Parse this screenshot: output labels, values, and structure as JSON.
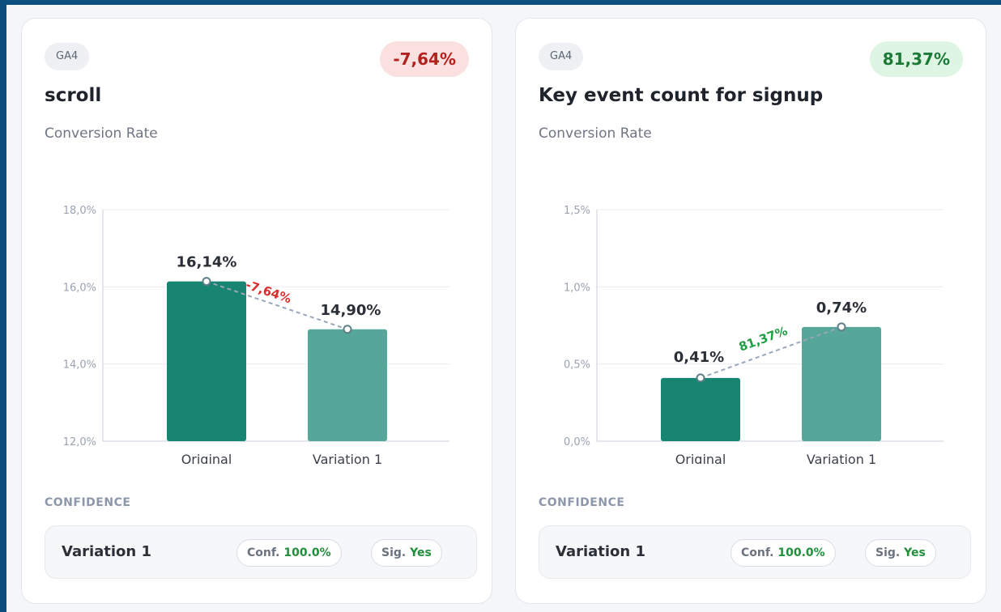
{
  "cards": [
    {
      "source_badge": "GA4",
      "change": "-7,64%",
      "change_direction": "negative",
      "title": "scroll",
      "subtitle": "Conversion Rate",
      "confidence_heading": "CONFIDENCE",
      "confidence": {
        "variation": "Variation 1",
        "conf_label": "Conf.",
        "conf_value": "100.0%",
        "sig_label": "Sig.",
        "sig_value": "Yes"
      }
    },
    {
      "source_badge": "GA4",
      "change": "81,37%",
      "change_direction": "positive",
      "title": "Key event count for signup",
      "subtitle": "Conversion Rate",
      "confidence_heading": "CONFIDENCE",
      "confidence": {
        "variation": "Variation 1",
        "conf_label": "Conf.",
        "conf_value": "100.0%",
        "sig_label": "Sig.",
        "sig_value": "Yes"
      }
    }
  ],
  "colors": {
    "original_bar": "#178572",
    "variation_bar": "#56a699",
    "negative": "#d92d2d",
    "negative_bg": "#fbe0e0",
    "negative_text": "#b3201e",
    "positive": "#1f9e44",
    "positive_bg": "#dff5e4",
    "positive_text": "#1a7a36",
    "grid": "#e8ecf2",
    "axis": "#c9d0db"
  },
  "chart_data": [
    {
      "type": "bar",
      "categories": [
        "Original",
        "Variation 1"
      ],
      "values": [
        16.14,
        14.9
      ],
      "value_labels": [
        "16,14%",
        "14,90%"
      ],
      "ylim": [
        12,
        18
      ],
      "yticks": [
        12,
        14,
        16,
        18
      ],
      "ytick_labels": [
        "12,0%",
        "14,0%",
        "16,0%",
        "18,0%"
      ],
      "annotation": "-7,64%",
      "grid": true
    },
    {
      "type": "bar",
      "categories": [
        "Original",
        "Variation 1"
      ],
      "values": [
        0.41,
        0.74
      ],
      "value_labels": [
        "0,41%",
        "0,74%"
      ],
      "ylim": [
        0,
        1.5
      ],
      "yticks": [
        0,
        0.5,
        1.0,
        1.5
      ],
      "ytick_labels": [
        "0,0%",
        "0,5%",
        "1,0%",
        "1,5%"
      ],
      "annotation": "81,37%",
      "grid": true
    }
  ]
}
